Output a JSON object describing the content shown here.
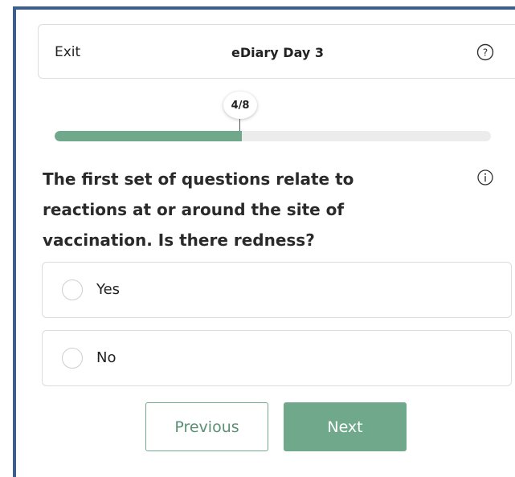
{
  "header": {
    "exit_label": "Exit",
    "title": "eDiary Day 3",
    "help_icon": "question-circle-icon"
  },
  "progress": {
    "label": "4/8",
    "current": 4,
    "total": 8,
    "fill_fraction": 0.43,
    "fill_color": "#6fa88a"
  },
  "question": {
    "text": "The first set of questions relate to reactions at or around the site of vaccination. Is there redness?",
    "info_icon": "info-circle-icon"
  },
  "options": [
    {
      "label": "Yes",
      "selected": false
    },
    {
      "label": "No",
      "selected": false
    }
  ],
  "buttons": {
    "previous": "Previous",
    "next": "Next"
  },
  "colors": {
    "accent": "#6fa88a",
    "frame": "#3d5f8a"
  }
}
